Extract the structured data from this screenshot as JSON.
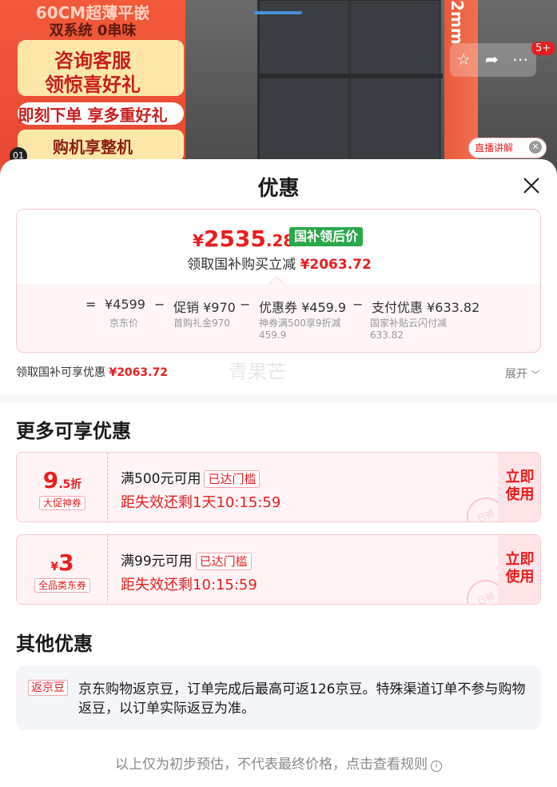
{
  "background": {
    "promo_lines": [
      "60CM超薄平嵌",
      "双系统 0串味",
      "咨询客服",
      "领惊喜好礼",
      "即刻下单 享多重好礼",
      "购机享整机"
    ],
    "promo_index": "01",
    "side_text": "2mm",
    "cart_badge": "5+",
    "live_label": "直播讲解",
    "icons": [
      "star-icon",
      "share-icon",
      "more-icon"
    ]
  },
  "sheet": {
    "title": "优惠",
    "price": {
      "yen": "¥",
      "integer": "2535",
      "decimal": ".28"
    },
    "gov_tag": "国补领后价",
    "sub_prefix": "领取国补购买立减",
    "sub_amount": "¥2063.72",
    "breakdown": {
      "equals": "=",
      "items": [
        {
          "main": "¥4599",
          "sub": "京东价"
        },
        {
          "op": "−",
          "main": "促销 ¥970",
          "sub": "首购礼金970"
        },
        {
          "op": "−",
          "main": "优惠券 ¥459.9",
          "sub": "神券满500享9折减",
          "sub2": "459.9"
        },
        {
          "op": "−",
          "main": "支付优惠 ¥633.82",
          "sub": "国家补贴云闪付减",
          "sub2": "633.82"
        }
      ]
    },
    "gov_line_prefix": "领取国补可享优惠",
    "gov_line_amount": "¥2063.72",
    "watermark": "青果芒",
    "expand_label": "展开"
  },
  "more": {
    "title": "更多可享优惠",
    "coupons": [
      {
        "value_big": "9",
        "value_small": ".5折",
        "kind": "大促神券",
        "condition": "满500元可用",
        "reached": "已达门槛",
        "timer": "距失效还剩1天10:15:59",
        "btn1": "立即",
        "btn2": "使用",
        "stamp": "已领"
      },
      {
        "value_small": "¥",
        "value_big": "3",
        "kind": "全品类东券",
        "condition": "满99元可用",
        "reached": "已达门槛",
        "timer": "距失效还剩10:15:59",
        "btn1": "立即",
        "btn2": "使用",
        "stamp": "已领"
      }
    ]
  },
  "other": {
    "title": "其他优惠",
    "tag": "返京豆",
    "text": "京东购物返京豆，订单完成后最高可返126京豆。特殊渠道订单不参与购物返豆，以订单实际返豆为准。"
  },
  "footer": {
    "note": "以上仅为初步预估，不代表最终价格，点击查看规则",
    "info": "i"
  },
  "colors": {
    "accent": "#e81e1e",
    "gov_green": "#2aa84a"
  }
}
